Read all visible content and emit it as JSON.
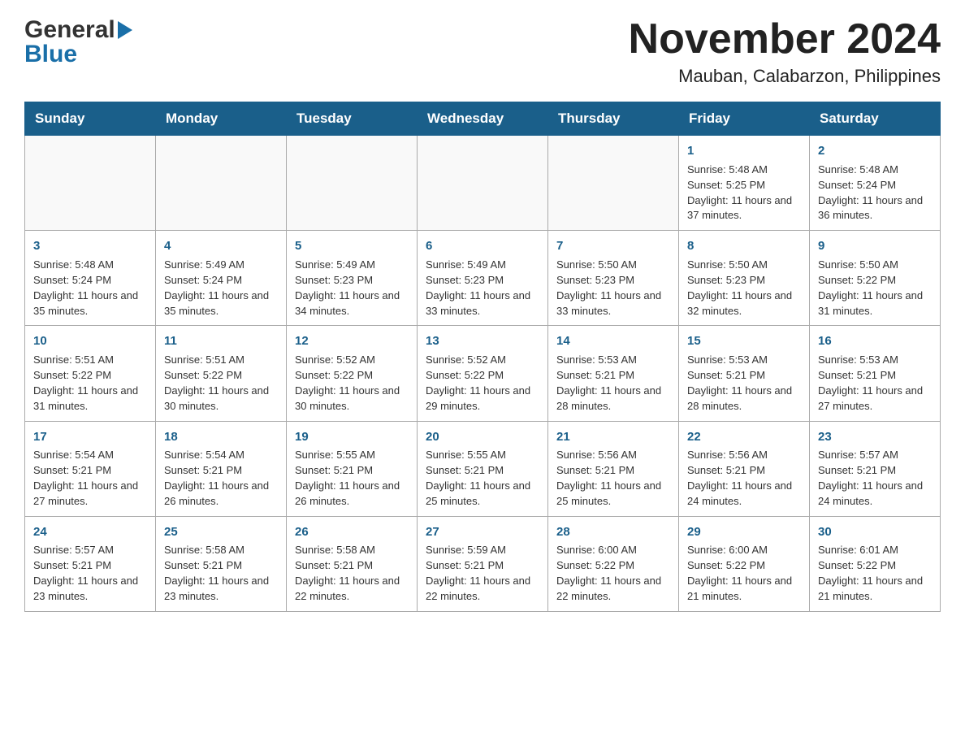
{
  "header": {
    "month_year": "November 2024",
    "location": "Mauban, Calabarzon, Philippines",
    "logo_general": "General",
    "logo_blue": "Blue"
  },
  "days_of_week": [
    "Sunday",
    "Monday",
    "Tuesday",
    "Wednesday",
    "Thursday",
    "Friday",
    "Saturday"
  ],
  "weeks": [
    [
      {
        "day": "",
        "sunrise": "",
        "sunset": "",
        "daylight": ""
      },
      {
        "day": "",
        "sunrise": "",
        "sunset": "",
        "daylight": ""
      },
      {
        "day": "",
        "sunrise": "",
        "sunset": "",
        "daylight": ""
      },
      {
        "day": "",
        "sunrise": "",
        "sunset": "",
        "daylight": ""
      },
      {
        "day": "",
        "sunrise": "",
        "sunset": "",
        "daylight": ""
      },
      {
        "day": "1",
        "sunrise": "Sunrise: 5:48 AM",
        "sunset": "Sunset: 5:25 PM",
        "daylight": "Daylight: 11 hours and 37 minutes."
      },
      {
        "day": "2",
        "sunrise": "Sunrise: 5:48 AM",
        "sunset": "Sunset: 5:24 PM",
        "daylight": "Daylight: 11 hours and 36 minutes."
      }
    ],
    [
      {
        "day": "3",
        "sunrise": "Sunrise: 5:48 AM",
        "sunset": "Sunset: 5:24 PM",
        "daylight": "Daylight: 11 hours and 35 minutes."
      },
      {
        "day": "4",
        "sunrise": "Sunrise: 5:49 AM",
        "sunset": "Sunset: 5:24 PM",
        "daylight": "Daylight: 11 hours and 35 minutes."
      },
      {
        "day": "5",
        "sunrise": "Sunrise: 5:49 AM",
        "sunset": "Sunset: 5:23 PM",
        "daylight": "Daylight: 11 hours and 34 minutes."
      },
      {
        "day": "6",
        "sunrise": "Sunrise: 5:49 AM",
        "sunset": "Sunset: 5:23 PM",
        "daylight": "Daylight: 11 hours and 33 minutes."
      },
      {
        "day": "7",
        "sunrise": "Sunrise: 5:50 AM",
        "sunset": "Sunset: 5:23 PM",
        "daylight": "Daylight: 11 hours and 33 minutes."
      },
      {
        "day": "8",
        "sunrise": "Sunrise: 5:50 AM",
        "sunset": "Sunset: 5:23 PM",
        "daylight": "Daylight: 11 hours and 32 minutes."
      },
      {
        "day": "9",
        "sunrise": "Sunrise: 5:50 AM",
        "sunset": "Sunset: 5:22 PM",
        "daylight": "Daylight: 11 hours and 31 minutes."
      }
    ],
    [
      {
        "day": "10",
        "sunrise": "Sunrise: 5:51 AM",
        "sunset": "Sunset: 5:22 PM",
        "daylight": "Daylight: 11 hours and 31 minutes."
      },
      {
        "day": "11",
        "sunrise": "Sunrise: 5:51 AM",
        "sunset": "Sunset: 5:22 PM",
        "daylight": "Daylight: 11 hours and 30 minutes."
      },
      {
        "day": "12",
        "sunrise": "Sunrise: 5:52 AM",
        "sunset": "Sunset: 5:22 PM",
        "daylight": "Daylight: 11 hours and 30 minutes."
      },
      {
        "day": "13",
        "sunrise": "Sunrise: 5:52 AM",
        "sunset": "Sunset: 5:22 PM",
        "daylight": "Daylight: 11 hours and 29 minutes."
      },
      {
        "day": "14",
        "sunrise": "Sunrise: 5:53 AM",
        "sunset": "Sunset: 5:21 PM",
        "daylight": "Daylight: 11 hours and 28 minutes."
      },
      {
        "day": "15",
        "sunrise": "Sunrise: 5:53 AM",
        "sunset": "Sunset: 5:21 PM",
        "daylight": "Daylight: 11 hours and 28 minutes."
      },
      {
        "day": "16",
        "sunrise": "Sunrise: 5:53 AM",
        "sunset": "Sunset: 5:21 PM",
        "daylight": "Daylight: 11 hours and 27 minutes."
      }
    ],
    [
      {
        "day": "17",
        "sunrise": "Sunrise: 5:54 AM",
        "sunset": "Sunset: 5:21 PM",
        "daylight": "Daylight: 11 hours and 27 minutes."
      },
      {
        "day": "18",
        "sunrise": "Sunrise: 5:54 AM",
        "sunset": "Sunset: 5:21 PM",
        "daylight": "Daylight: 11 hours and 26 minutes."
      },
      {
        "day": "19",
        "sunrise": "Sunrise: 5:55 AM",
        "sunset": "Sunset: 5:21 PM",
        "daylight": "Daylight: 11 hours and 26 minutes."
      },
      {
        "day": "20",
        "sunrise": "Sunrise: 5:55 AM",
        "sunset": "Sunset: 5:21 PM",
        "daylight": "Daylight: 11 hours and 25 minutes."
      },
      {
        "day": "21",
        "sunrise": "Sunrise: 5:56 AM",
        "sunset": "Sunset: 5:21 PM",
        "daylight": "Daylight: 11 hours and 25 minutes."
      },
      {
        "day": "22",
        "sunrise": "Sunrise: 5:56 AM",
        "sunset": "Sunset: 5:21 PM",
        "daylight": "Daylight: 11 hours and 24 minutes."
      },
      {
        "day": "23",
        "sunrise": "Sunrise: 5:57 AM",
        "sunset": "Sunset: 5:21 PM",
        "daylight": "Daylight: 11 hours and 24 minutes."
      }
    ],
    [
      {
        "day": "24",
        "sunrise": "Sunrise: 5:57 AM",
        "sunset": "Sunset: 5:21 PM",
        "daylight": "Daylight: 11 hours and 23 minutes."
      },
      {
        "day": "25",
        "sunrise": "Sunrise: 5:58 AM",
        "sunset": "Sunset: 5:21 PM",
        "daylight": "Daylight: 11 hours and 23 minutes."
      },
      {
        "day": "26",
        "sunrise": "Sunrise: 5:58 AM",
        "sunset": "Sunset: 5:21 PM",
        "daylight": "Daylight: 11 hours and 22 minutes."
      },
      {
        "day": "27",
        "sunrise": "Sunrise: 5:59 AM",
        "sunset": "Sunset: 5:21 PM",
        "daylight": "Daylight: 11 hours and 22 minutes."
      },
      {
        "day": "28",
        "sunrise": "Sunrise: 6:00 AM",
        "sunset": "Sunset: 5:22 PM",
        "daylight": "Daylight: 11 hours and 22 minutes."
      },
      {
        "day": "29",
        "sunrise": "Sunrise: 6:00 AM",
        "sunset": "Sunset: 5:22 PM",
        "daylight": "Daylight: 11 hours and 21 minutes."
      },
      {
        "day": "30",
        "sunrise": "Sunrise: 6:01 AM",
        "sunset": "Sunset: 5:22 PM",
        "daylight": "Daylight: 11 hours and 21 minutes."
      }
    ]
  ]
}
